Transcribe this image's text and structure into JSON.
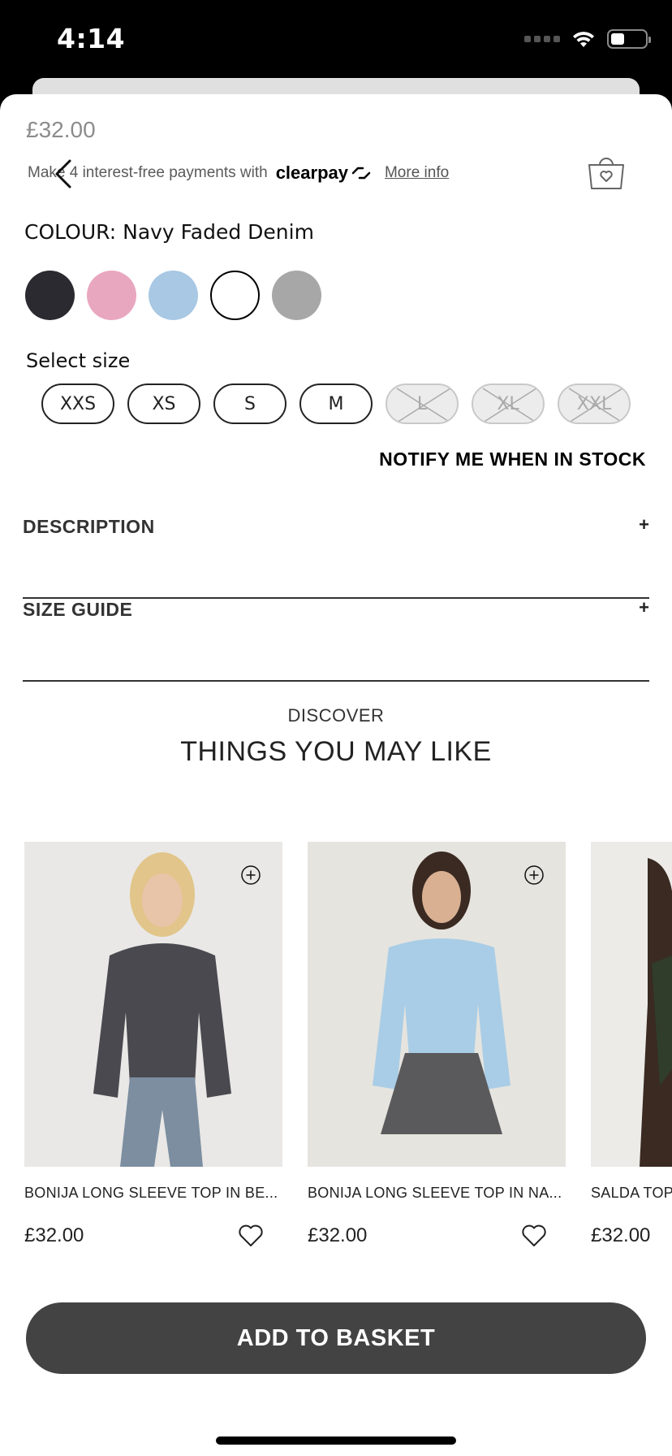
{
  "status_bar": {
    "time": "4:14"
  },
  "product": {
    "price": "£32.00",
    "payments_text": "Make 4 interest-free payments with",
    "clearpay_label": "clearpay",
    "more_info": "More info",
    "colour_label": "COLOUR: Navy Faded Denim",
    "swatches": [
      {
        "name": "charcoal",
        "color": "#2b2a30"
      },
      {
        "name": "pink",
        "color": "#e9a7bf"
      },
      {
        "name": "light-blue",
        "color": "#a8c8e4"
      },
      {
        "name": "navy-faded-denim",
        "color": "#ffffff",
        "selected": true
      },
      {
        "name": "grey",
        "color": "#a7a7a7"
      }
    ],
    "select_size": "Select size",
    "sizes": [
      {
        "label": "XXS",
        "available": true
      },
      {
        "label": "XS",
        "available": true
      },
      {
        "label": "S",
        "available": true
      },
      {
        "label": "M",
        "available": true
      },
      {
        "label": "L",
        "available": false
      },
      {
        "label": "XL",
        "available": false
      },
      {
        "label": "XXL",
        "available": false
      }
    ],
    "notify": "NOTIFY ME WHEN IN STOCK"
  },
  "accordions": [
    {
      "title": "DESCRIPTION",
      "icon": "+"
    },
    {
      "title": "SIZE GUIDE",
      "icon": "+"
    }
  ],
  "recommendations": {
    "eyebrow": "DISCOVER",
    "title": "THINGS YOU MAY LIKE",
    "items": [
      {
        "name": "BONIJA LONG SLEEVE TOP IN BE...",
        "price": "£32.00",
        "top_color": "#4a4950",
        "bg": "#e9e8e6"
      },
      {
        "name": "BONIJA LONG SLEEVE TOP IN NA...",
        "price": "£32.00",
        "top_color": "#a9cde6",
        "bg": "#e6e4df"
      },
      {
        "name": "SALDA TOP",
        "price": "£32.00",
        "top_color": "#2f3d2a",
        "bg": "#ecebe8"
      }
    ]
  },
  "cta": {
    "add_to_basket": "ADD TO BASKET"
  }
}
